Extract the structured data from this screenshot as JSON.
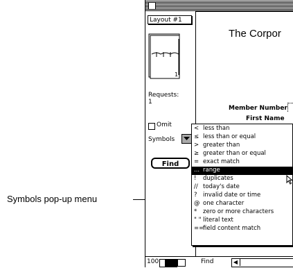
{
  "callout": {
    "label": "Symbols pop-up menu"
  },
  "window": {
    "title_text": "The Corpor"
  },
  "status_area": {
    "layout_popup": "Layout #1",
    "book_page": "1",
    "requests_label": "Requests:",
    "requests_count": "1",
    "omit_label": "Omit",
    "symbols_label": "Symbols",
    "find_button": "Find"
  },
  "fields": {
    "member_number_label": "Member Number",
    "first_name_label": "First Name"
  },
  "symbols_menu": {
    "items": [
      {
        "symbol": "<",
        "label": "less than"
      },
      {
        "symbol": "≤",
        "label": "less than or equal"
      },
      {
        "symbol": ">",
        "label": "greater than"
      },
      {
        "symbol": "≥",
        "label": "greater than or equal"
      },
      {
        "symbol": "=",
        "label": "exact match"
      },
      {
        "symbol": "...",
        "label": "range"
      },
      {
        "symbol": "!",
        "label": "duplicates"
      },
      {
        "symbol": "//",
        "label": "today's date"
      },
      {
        "symbol": "?",
        "label": "invalid date or time"
      },
      {
        "symbol": "@",
        "label": "one character"
      },
      {
        "symbol": "*",
        "label": "zero or more characters"
      },
      {
        "symbol": "\" \"",
        "label": "literal text"
      },
      {
        "symbol": "==",
        "label": "field content match"
      }
    ],
    "selected_label": "range"
  },
  "bottom_bar": {
    "zoom_level": "100",
    "mode": "Find"
  }
}
